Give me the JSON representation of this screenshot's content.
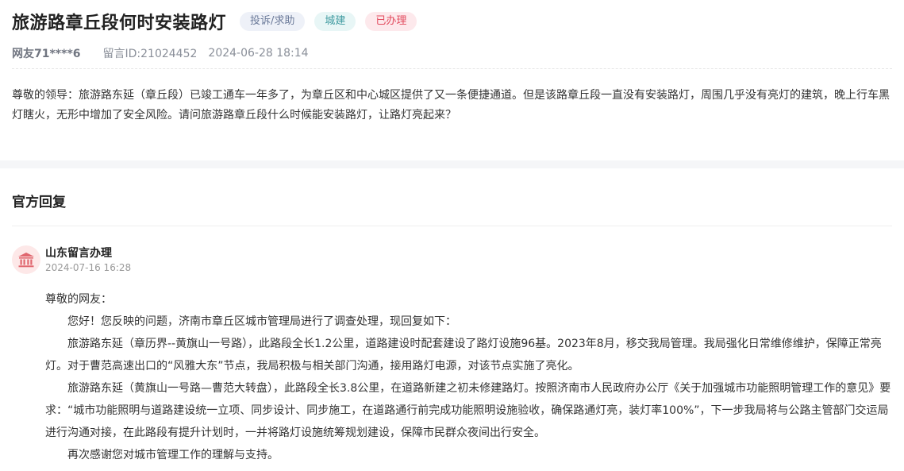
{
  "post": {
    "title": "旅游路章丘段何时安装路灯",
    "tags": {
      "type": "投诉/求助",
      "category": "城建",
      "status": "已办理"
    },
    "user": "网友71****6",
    "message_id": "留言ID:21024452",
    "datetime": "2024-06-28 18:14",
    "content": "尊敬的领导：旅游路东延（章丘段）已竣工通车一年多了，为章丘区和中心城区提供了又一条便捷通道。但是该路章丘段一直没有安装路灯，周围几乎没有亮灯的建筑，晚上行车黑灯瞎火，无形中增加了安全风险。请问旅游路章丘段什么时候能安装路灯，让路灯亮起来？"
  },
  "reply": {
    "heading": "官方回复",
    "organization": "山东留言办理",
    "datetime": "2024-07-16 16:28",
    "avatar_icon": "government-building-icon",
    "salutation": "尊敬的网友：",
    "paragraphs": [
      "您好！您反映的问题，济南市章丘区城市管理局进行了调查处理，现回复如下：",
      "旅游路东延（章历界--黄旗山一号路），此路段全长1.2公里，道路建设时配套建设了路灯设施96基。2023年8月，移交我局管理。我局强化日常维修维护，保障正常亮灯。对于曹范高速出口的“风雅大东”节点，我局积极与相关部门沟通，接用路灯电源，对该节点实施了亮化。",
      "旅游路东延（黄旗山一号路—曹范大转盘），此路段全长3.8公里，在道路新建之初未修建路灯。按照济南市人民政府办公厅《关于加强城市功能照明管理工作的意见》要求：“城市功能照明与道路建设统一立项、同步设计、同步施工，在道路通行前完成功能照明设施验收，确保路通灯亮，装灯率100%”，下一步我局将与公路主管部门交运局进行沟通对接，在此路段有提升计划时，一并将路灯设施统筹规划建设，保障市民群众夜间出行安全。",
      "再次感谢您对城市管理工作的理解与支持。"
    ]
  },
  "colors": {
    "status_tag": "#e24b5e",
    "category_tag": "#3f9aa0",
    "type_tag": "#6b7a99",
    "avatar_bg": "#fde8e8",
    "avatar_icon": "#e0676f"
  }
}
